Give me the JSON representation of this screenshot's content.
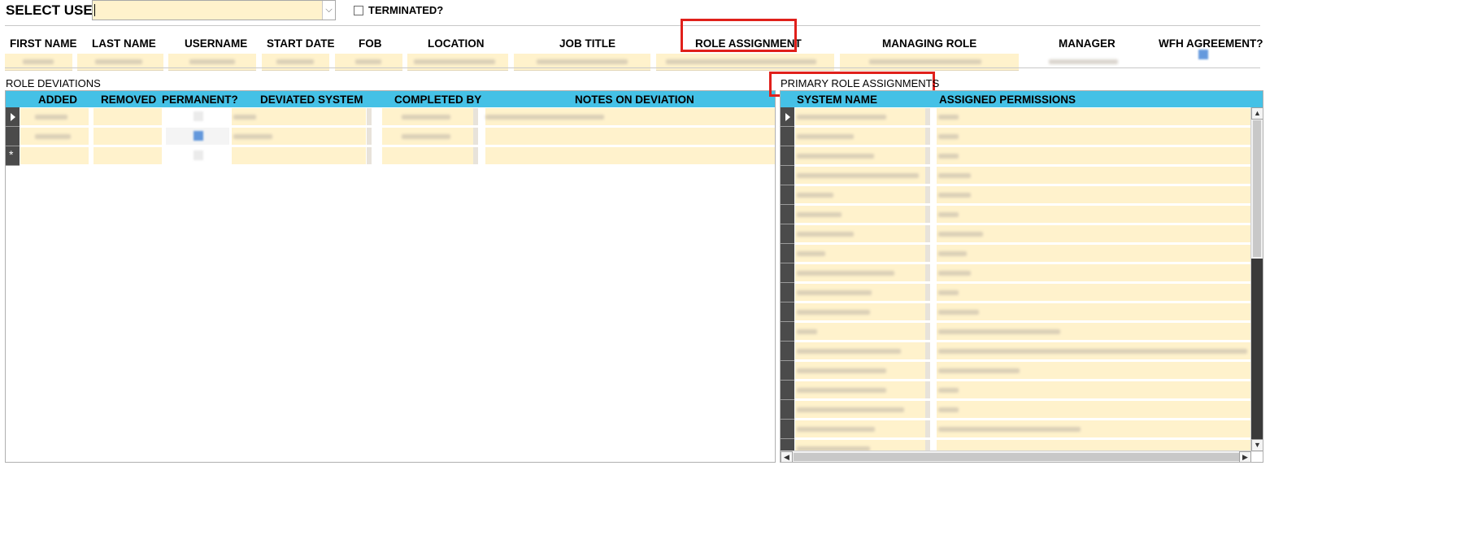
{
  "select_user": {
    "label": "SELECT USER:",
    "value": "",
    "terminated_label": "TERMINATED?",
    "terminated_checked": false
  },
  "user_fields": [
    {
      "label": "FIRST NAME"
    },
    {
      "label": "LAST NAME"
    },
    {
      "label": "USERNAME"
    },
    {
      "label": "START DATE"
    },
    {
      "label": "FOB"
    },
    {
      "label": "LOCATION"
    },
    {
      "label": "JOB TITLE"
    },
    {
      "label": "ROLE ASSIGNMENT"
    },
    {
      "label": "MANAGING ROLE"
    },
    {
      "label": "MANAGER"
    },
    {
      "label": "WFH AGREEMENT?"
    }
  ],
  "role_deviations": {
    "title": "ROLE DEVIATIONS",
    "columns": [
      "ADDED",
      "REMOVED",
      "PERMANENT?",
      "DEVIATED SYSTEM",
      "COMPLETED BY",
      "NOTES ON DEVIATION"
    ],
    "new_row_marker": "*"
  },
  "primary_role_assignments": {
    "title": "PRIMARY ROLE ASSIGNMENTS",
    "columns": [
      "SYSTEM NAME",
      "ASSIGNED PERMISSIONS"
    ]
  },
  "colors": {
    "grid_header": "#45c1e6",
    "field_bg": "#fff2cc",
    "highlight_box": "#e0201b",
    "record_selector": "#4b4b4b"
  }
}
